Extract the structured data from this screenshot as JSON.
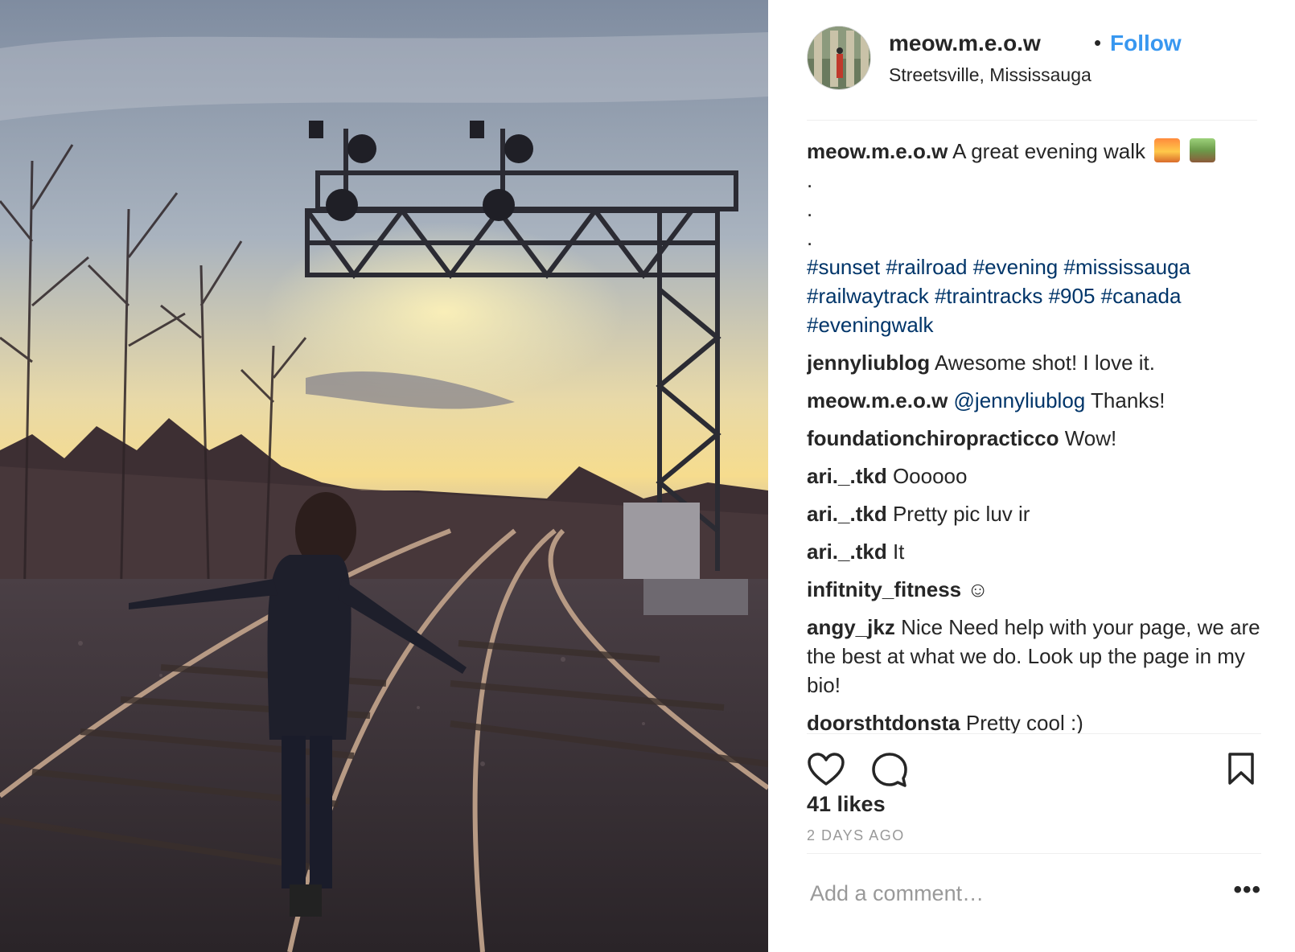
{
  "post": {
    "username": "meow.m.e.o.w",
    "separator": "•",
    "follow_label": "Follow",
    "location": "Streetsville, Mississauga",
    "photo_alt": "photo",
    "avatar_icon": "avatar-icon"
  },
  "caption": {
    "username": "meow.m.e.o.w",
    "text": "A great evening walk",
    "emojis": [
      "sunset-emoji",
      "railway-track-emoji"
    ],
    "dots": [
      ".",
      ".",
      "."
    ],
    "hashtags_line1": [
      "#sunset",
      "#railroad",
      "#evening",
      "#mississauga"
    ],
    "hashtags_line2": [
      "#railwaytrack",
      "#traintracks",
      "#905",
      "#canada"
    ],
    "hashtags_line3": [
      "#eveningwalk"
    ]
  },
  "comments": [
    {
      "username": "jennyliublog",
      "mention": "",
      "text": "Awesome shot! I love it."
    },
    {
      "username": "meow.m.e.o.w",
      "mention": "@jennyliublog",
      "text": "Thanks!"
    },
    {
      "username": "foundationchiropracticco",
      "mention": "",
      "text": "Wow!"
    },
    {
      "username": "ari._.tkd",
      "mention": "",
      "text": "Oooooo"
    },
    {
      "username": "ari._.tkd",
      "mention": "",
      "text": "Pretty pic luv ir"
    },
    {
      "username": "ari._.tkd",
      "mention": "",
      "text": "It"
    },
    {
      "username": "infitnity_fitness",
      "mention": "",
      "text": "☺"
    },
    {
      "username": "angy_jkz",
      "mention": "",
      "text": "Nice Need help with your page, we are the best at what we do. Look up the page in my bio!"
    },
    {
      "username": "doorsthtdonsta",
      "mention": "",
      "text": "Pretty cool :)"
    }
  ],
  "actions": {
    "like_icon": "heart-icon",
    "comment_icon": "comment-icon",
    "save_icon": "bookmark-icon",
    "likes": "41 likes",
    "timestamp": "2 DAYS AGO",
    "add_comment_placeholder": "Add a comment…",
    "more_label": "•••"
  },
  "colors": {
    "link": "#3897f0",
    "hashtag": "#003569",
    "muted": "#999999",
    "text": "#262626"
  }
}
